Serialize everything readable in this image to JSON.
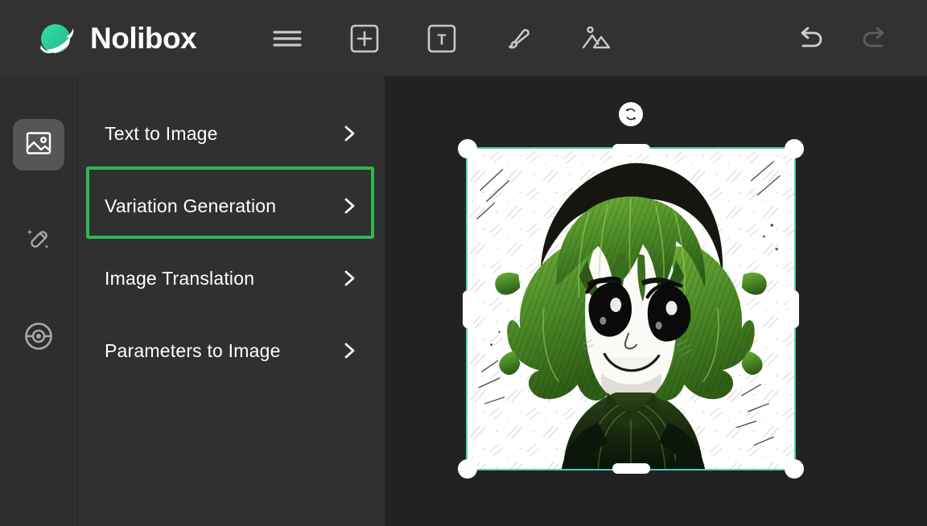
{
  "app": {
    "brand_name": "Nolibox",
    "logo_icon": "planet-logo-icon",
    "accent_green": "#2eb84f",
    "selection_teal": "#4ecdb4",
    "header_bg": "#323232",
    "panel_bg": "#303030",
    "canvas_bg": "#222222"
  },
  "header": {
    "tools": [
      {
        "name": "menu-icon",
        "label": "Menu"
      },
      {
        "name": "add-element-icon",
        "label": "Add"
      },
      {
        "name": "text-tool-icon",
        "label": "Text"
      },
      {
        "name": "brush-tool-icon",
        "label": "Brush"
      },
      {
        "name": "image-tool-icon",
        "label": "Image"
      }
    ],
    "history": [
      {
        "name": "undo-icon",
        "label": "Undo",
        "state": "enabled"
      },
      {
        "name": "redo-icon",
        "label": "Redo",
        "state": "disabled"
      }
    ]
  },
  "sidebar": {
    "items": [
      {
        "name": "sidebar-item-image",
        "icon": "image-icon",
        "label": "Image",
        "active": true
      },
      {
        "name": "sidebar-item-magic-wand",
        "icon": "magic-wand-icon",
        "label": "Magic Wand",
        "active": false
      },
      {
        "name": "sidebar-item-model",
        "icon": "model-ball-icon",
        "label": "Model",
        "active": false
      }
    ]
  },
  "panel": {
    "items": [
      {
        "label": "Text to Image",
        "chevron": "chevron-right-icon",
        "highlighted": false
      },
      {
        "label": "Variation Generation",
        "chevron": "chevron-right-icon",
        "highlighted": true
      },
      {
        "label": "Image Translation",
        "chevron": "chevron-right-icon",
        "highlighted": false
      },
      {
        "label": "Parameters to Image",
        "chevron": "chevron-right-icon",
        "highlighted": false
      }
    ]
  },
  "canvas": {
    "selection": {
      "rotate_handle_icon": "rotate-icon",
      "handles": [
        "top-left",
        "top-right",
        "bottom-left",
        "bottom-right",
        "top-center",
        "bottom-center",
        "left-center",
        "right-center"
      ]
    },
    "artwork": {
      "name": "anime-girl-green-hair-illustration",
      "description": "Manga-style ink sketch of a smiling girl with curly green hair on a white textured background"
    }
  }
}
